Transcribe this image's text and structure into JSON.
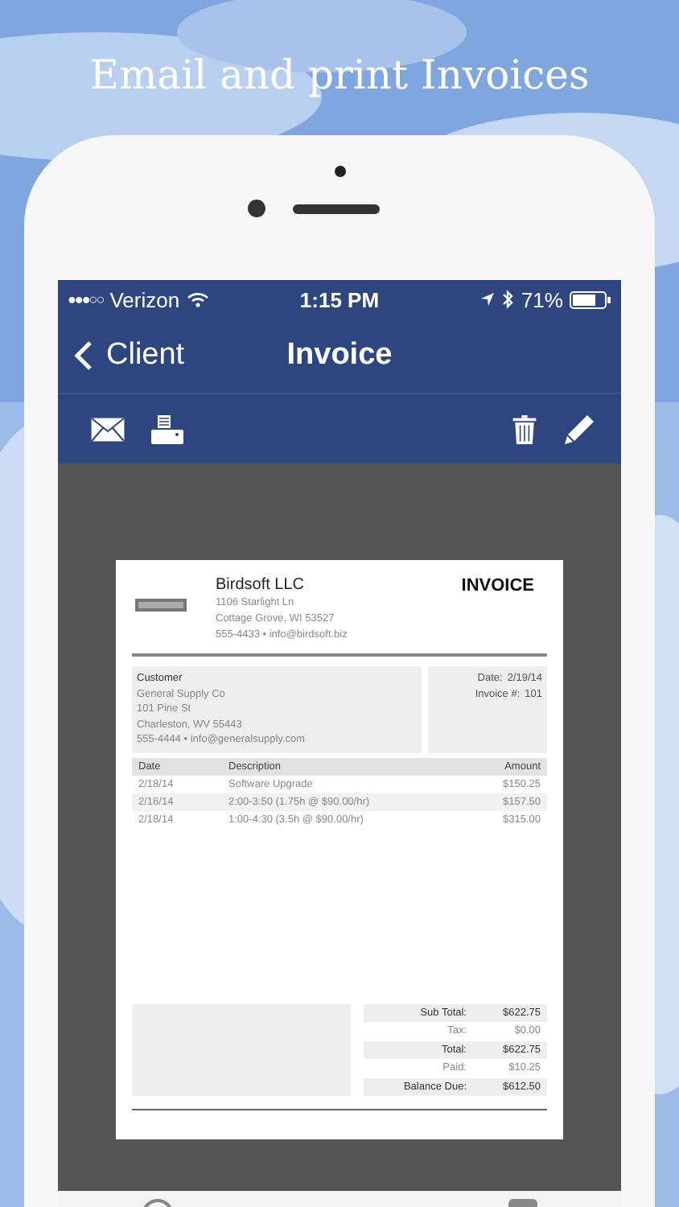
{
  "headline": "Email and print Invoices",
  "status_bar": {
    "signal": "●●●○○",
    "carrier": "Verizon",
    "time": "1:15 PM",
    "battery": "71%"
  },
  "nav_bar": {
    "back": "Client",
    "title": "Invoice"
  },
  "document": {
    "company": {
      "name": "Birdsoft LLC",
      "lines": [
        "1106 Starlight Ln",
        "Cottage Grove, WI 53527",
        "555-4433 • info@birdsoft.biz"
      ]
    },
    "heading": "INVOICE",
    "customer": {
      "label": "Customer",
      "lines": [
        "General Supply Co",
        "101 Pine St",
        "Charleston, WV 55443",
        "555-4444 • info@generalsupply.com"
      ]
    },
    "meta": [
      {
        "label": "Date:",
        "value": "2/19/14"
      },
      {
        "label": "Invoice #:",
        "value": "101"
      }
    ],
    "table": {
      "columns": [
        "Date",
        "Description",
        "Amount"
      ],
      "rows": [
        [
          "2/18/14",
          "Software Upgrade",
          "$150.25"
        ],
        [
          "2/16/14",
          "2:00-3:50 (1.75h @ $90.00/hr)",
          "$157.50"
        ],
        [
          "2/18/14",
          "1:00-4:30 (3.5h @ $90.00/hr)",
          "$315.00"
        ]
      ]
    },
    "totals": [
      {
        "label": "Sub Total:",
        "value": "$622.75"
      },
      {
        "label": "Tax:",
        "value": "$0.00"
      },
      {
        "label": "Total:",
        "value": "$622.75"
      },
      {
        "label": "Paid:",
        "value": "$10.25"
      },
      {
        "label": "Balance Due:",
        "value": "$612.50"
      }
    ]
  }
}
